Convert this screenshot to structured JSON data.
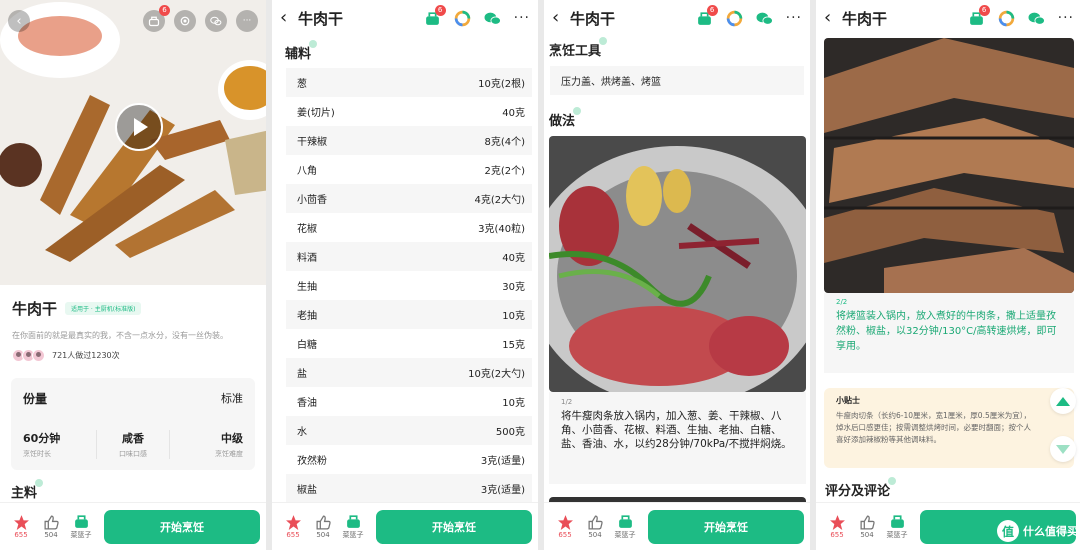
{
  "colors": {
    "accent": "#1dbb84",
    "fav": "#e94e58",
    "badge": "#f04a4a",
    "tipBg": "#fdf3e0"
  },
  "common": {
    "back": "‹",
    "title": "牛肉干",
    "more": "···",
    "badge": "6",
    "bottom": {
      "fav_count": "655",
      "like_count": "504",
      "basket_label": "菜篮子",
      "start_label": "开始烹饪"
    }
  },
  "p1": {
    "title": "牛肉干",
    "tag": "适用于 · 主厨机(标准版)",
    "desc": "在你面前的就是最真实的我，不含一点水分，没有一丝伪装。",
    "made": "721人做过1230次",
    "portion_label": "份量",
    "portion_value": "标准",
    "stats": [
      {
        "value": "60分钟",
        "label": "烹饪时长"
      },
      {
        "value": "咸香",
        "label": "口味口感"
      },
      {
        "value": "中级",
        "label": "烹饪难度"
      }
    ],
    "zhuliao": "主料"
  },
  "p2": {
    "section": "辅料",
    "ingredients": [
      {
        "name": "葱",
        "amount": "10克(2根)"
      },
      {
        "name": "姜(切片)",
        "amount": "40克"
      },
      {
        "name": "干辣椒",
        "amount": "8克(4个)"
      },
      {
        "name": "八角",
        "amount": "2克(2个)"
      },
      {
        "name": "小茴香",
        "amount": "4克(2大勺)"
      },
      {
        "name": "花椒",
        "amount": "3克(40粒)"
      },
      {
        "name": "料酒",
        "amount": "40克"
      },
      {
        "name": "生抽",
        "amount": "30克"
      },
      {
        "name": "老抽",
        "amount": "10克"
      },
      {
        "name": "白糖",
        "amount": "15克"
      },
      {
        "name": "盐",
        "amount": "10克(2大勺)"
      },
      {
        "name": "香油",
        "amount": "10克"
      },
      {
        "name": "水",
        "amount": "500克"
      },
      {
        "name": "孜然粉",
        "amount": "3克(适量)"
      },
      {
        "name": "椒盐",
        "amount": "3克(适量)"
      }
    ]
  },
  "p3": {
    "tools_title": "烹饪工具",
    "tools": "压力盖、烘烤盖、烤篮",
    "method_title": "做法",
    "step_num": "1/2",
    "step_text": "将牛瘦肉条放入锅内，加入葱、姜、干辣椒、八角、小茴香、花椒、料酒、生抽、老抽、白糖、盐、香油、水，以约28分钟/70kPa/不搅拌焖烧。"
  },
  "p4": {
    "step_num": "2/2",
    "step_text": "将烤篮装入锅内，放入煮好的牛肉条，撒上适量孜然粉、椒盐，以32分钟/130°C/高转速烘烤，即可享用。",
    "tip_title": "小贴士",
    "tip_text": "牛瘦肉切条（长约6-10厘米，宽1厘米，厚0.5厘米为宜），焯水后口感更佳；按需调整烘烤时间，必要时翻面；按个人喜好添加辣椒粉等其他调味料。",
    "reviews_title": "评分及评论",
    "watermark": "什么值得买"
  }
}
